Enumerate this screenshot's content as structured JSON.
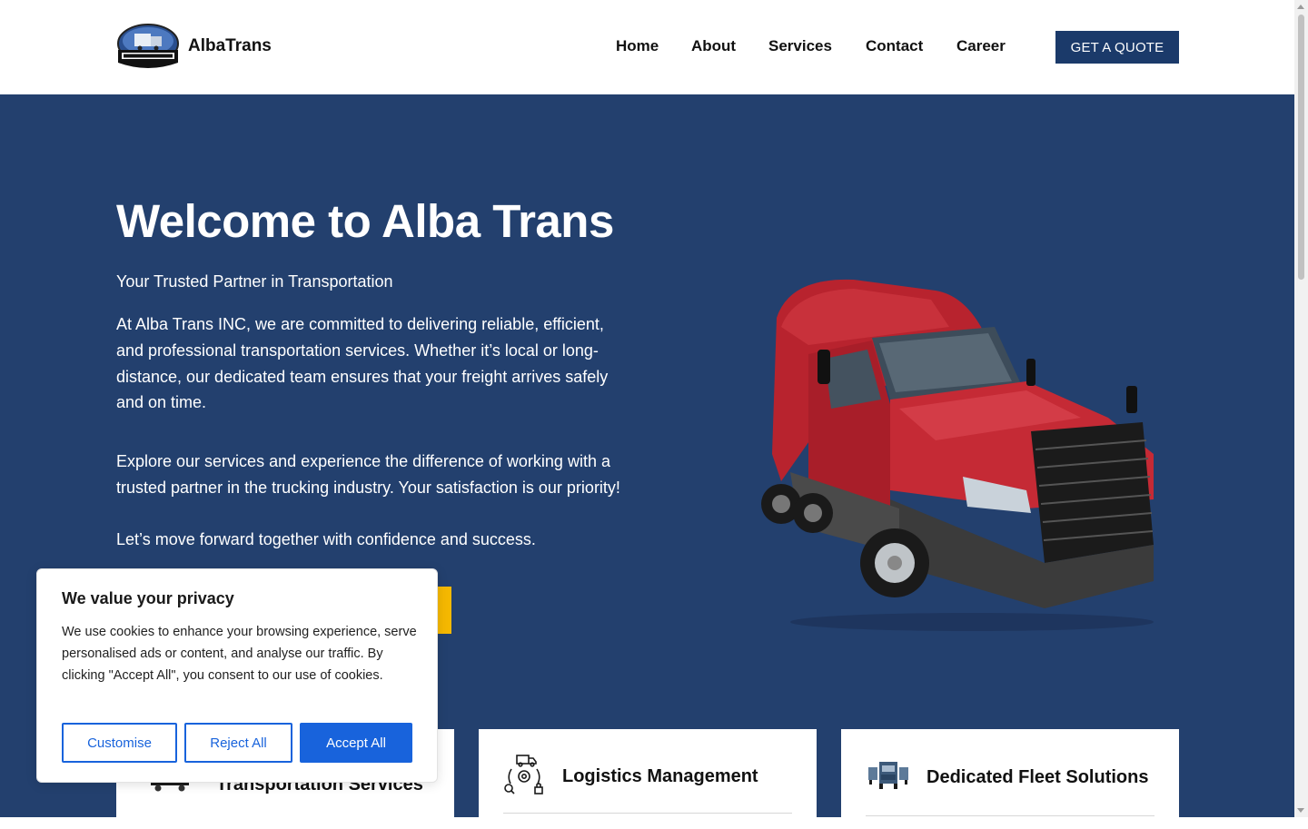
{
  "header": {
    "brand": "AlbaTrans",
    "logo_text": "ALBA TRANS INC",
    "nav": [
      {
        "label": "Home"
      },
      {
        "label": "About"
      },
      {
        "label": "Services"
      },
      {
        "label": "Contact"
      },
      {
        "label": "Career"
      }
    ],
    "quote_label": "GET A QUOTE"
  },
  "hero": {
    "title": "Welcome to Alba Trans",
    "subtitle": "Your Trusted Partner in Transportation",
    "paragraph1": "At Alba Trans INC, we are committed to delivering reliable, efficient, and professional transportation services. Whether it’s local or long-distance, our dedicated team ensures that your freight arrives safely and on time.",
    "paragraph2": "Explore our services and experience the difference of working with a trusted partner in the trucking industry. Your satisfaction is our priority!",
    "paragraph3": "Let’s move forward together with confidence and success."
  },
  "services": [
    {
      "title": "Transportation Services",
      "icon": "truck-icon"
    },
    {
      "title": "Logistics Management",
      "icon": "logistics-icon"
    },
    {
      "title": "Dedicated Fleet Solutions",
      "icon": "fleet-icon"
    }
  ],
  "cookie": {
    "title": "We value your privacy",
    "text": "We use cookies to enhance your browsing experience, serve personalised ads or content, and analyse our traffic. By clicking \"Accept All\", you consent to our use of cookies.",
    "customise_label": "Customise",
    "reject_label": "Reject All",
    "accept_label": "Accept All"
  },
  "colors": {
    "hero_bg": "#23406e",
    "quote_button": "#1b3a6a",
    "accent_yellow": "#f5b800",
    "cookie_blue": "#1863dc"
  }
}
